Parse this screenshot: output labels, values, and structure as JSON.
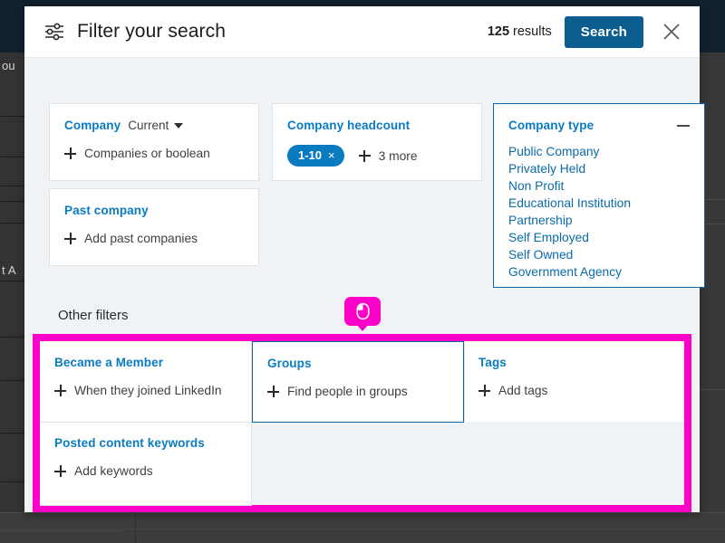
{
  "header": {
    "icon": "filters-sliders-icon",
    "title": "Filter your search",
    "results_text_count": "125",
    "results_text_suffix": " results",
    "search_label": "Search",
    "close_icon": "close-icon"
  },
  "top_filters": [
    {
      "id": "company",
      "title": "Company",
      "subtitle": "Current",
      "has_caret": true,
      "add_label": "Companies or boolean"
    },
    {
      "id": "past-company",
      "title": "Past company",
      "add_label": "Add past companies"
    },
    {
      "id": "company-headcount",
      "title": "Company headcount",
      "pill_label": "1-10",
      "pill_remove": "×",
      "more_label": "3 more"
    },
    {
      "id": "company-type",
      "title": "Company type",
      "collapse_icon": "minus-icon",
      "options": [
        "Public Company",
        "Privately Held",
        "Non Profit",
        "Educational Institution",
        "Partnership",
        "Self Employed",
        "Self Owned",
        "Government Agency"
      ]
    }
  ],
  "other_filters": {
    "heading": "Other filters",
    "cards": [
      {
        "id": "became-a-member",
        "title": "Became a Member",
        "add_label": "When they joined LinkedIn"
      },
      {
        "id": "groups",
        "title": "Groups",
        "add_label": "Find people in groups"
      },
      {
        "id": "tags",
        "title": "Tags",
        "add_label": "Add tags"
      },
      {
        "id": "posted-content-keywords",
        "title": "Posted content keywords",
        "add_label": "Add keywords"
      }
    ]
  },
  "annotation": {
    "cursor_icon": "mouse-cursor-icon",
    "highlight_color": "#ff00c8"
  },
  "backdrop": {
    "left_text_1": "ou",
    "left_text_2": "t A"
  },
  "colors": {
    "accent_blue": "#0b7bc1",
    "link_blue": "#0a6ba8",
    "button_blue": "#0b5c8f",
    "panel_bg": "#eff3f6",
    "highlight": "#ff00c8"
  }
}
